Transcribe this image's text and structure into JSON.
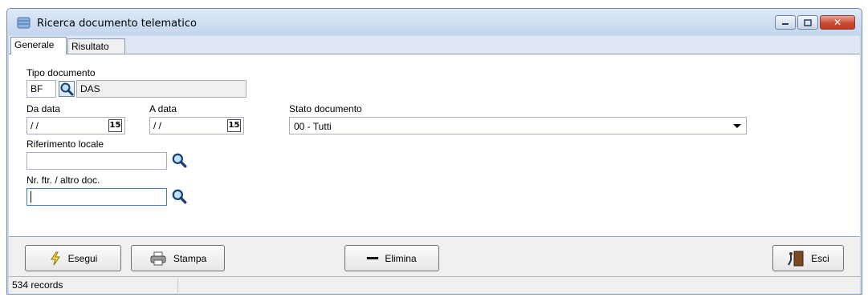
{
  "window": {
    "title": "Ricerca documento telematico",
    "icon": "database-icon",
    "controls": {
      "minimize_icon": "minimize-icon",
      "maximize_icon": "maximize-icon",
      "close_icon": "close-icon",
      "close_label": "✕"
    }
  },
  "tabs": [
    {
      "label": "Generale",
      "active": true
    },
    {
      "label": "Risultato",
      "active": false
    }
  ],
  "form": {
    "tipo_documento": {
      "label": "Tipo documento",
      "code": "BF",
      "description": "DAS"
    },
    "da_data": {
      "label": "Da data",
      "value": "/ /",
      "calendar_label": "15"
    },
    "a_data": {
      "label": "A data",
      "value": "/ /",
      "calendar_label": "15"
    },
    "stato_documento": {
      "label": "Stato documento",
      "selected": "00 - Tutti"
    },
    "riferimento_locale": {
      "label": "Riferimento locale",
      "value": ""
    },
    "nr_ftr": {
      "label": "Nr. ftr. / altro doc.",
      "value": ""
    }
  },
  "buttons": {
    "esegui": {
      "label": "Esegui",
      "icon": "lightning-icon"
    },
    "stampa": {
      "label": "Stampa",
      "icon": "printer-icon"
    },
    "elimina": {
      "label": "Elimina",
      "icon": "minus-icon"
    },
    "esci": {
      "label": "Esci",
      "icon": "exit-door-icon"
    }
  },
  "status": {
    "records": "534 records",
    "secondary": ""
  },
  "colors": {
    "title_bar": "#c4d7ee",
    "close_button": "#c23c25",
    "panel": "#ffffff",
    "button_bar": "#f0f0f0"
  }
}
